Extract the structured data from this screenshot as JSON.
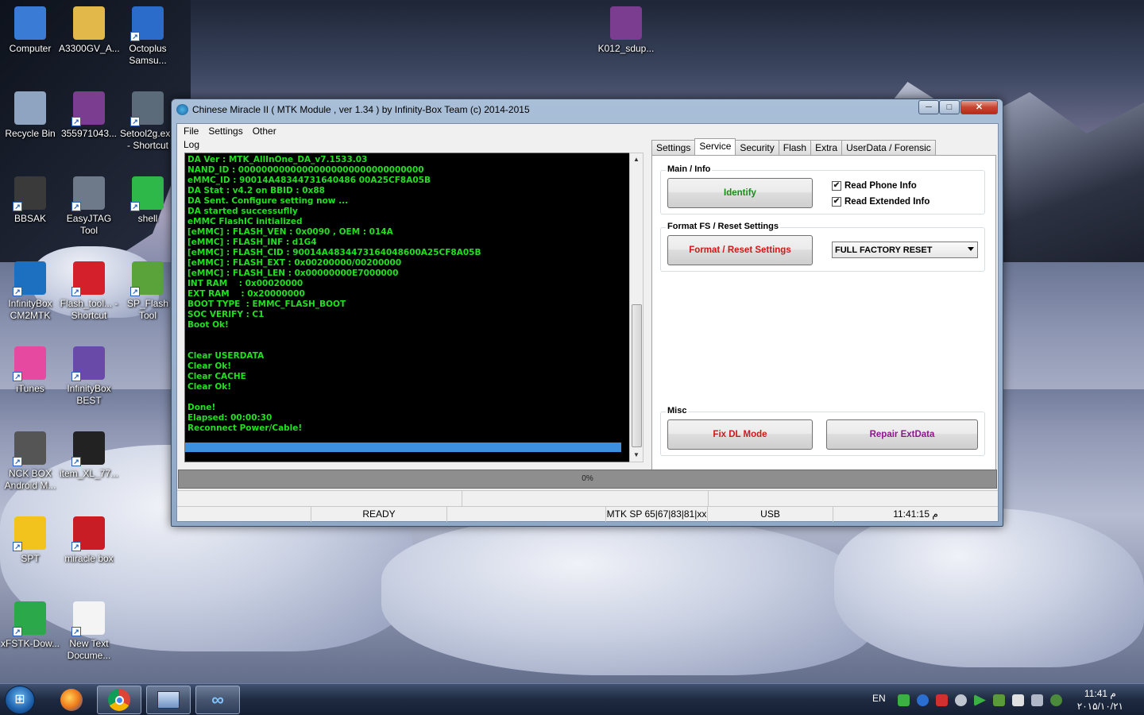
{
  "desktop": {
    "icons": [
      {
        "label": "Computer",
        "color": "#3a7bd5"
      },
      {
        "label": "A3300GV_A...",
        "color": "#e2b84b"
      },
      {
        "label": "Octoplus Samsu...",
        "color": "#2b6bc9"
      },
      {
        "label": "Recycle Bin",
        "color": "#8fa4c0"
      },
      {
        "label": "355971043...",
        "color": "#7a3d8f"
      },
      {
        "label": "Setool2g.exe - Shortcut",
        "color": "#5b6b7a"
      },
      {
        "label": "BBSAK",
        "color": "#3a3a3a"
      },
      {
        "label": "EasyJTAG Tool",
        "color": "#6e7a8a"
      },
      {
        "label": "shell",
        "color": "#2fb84a"
      },
      {
        "label": "InfinityBox CM2MTK",
        "color": "#1d6fbf"
      },
      {
        "label": "Flash_tool... - Shortcut",
        "color": "#d4202a"
      },
      {
        "label": "SP_Flash Tool",
        "color": "#5aa33b"
      },
      {
        "label": "iTunes",
        "color": "#e54aa0"
      },
      {
        "label": "InfinityBox BEST",
        "color": "#6a4aa8"
      },
      {
        "label": "NCK BOX Android M...",
        "color": "#555555"
      },
      {
        "label": "item_XL_77...",
        "color": "#222222"
      },
      {
        "label": "SPT",
        "color": "#f2c31c"
      },
      {
        "label": "miracle box",
        "color": "#c81d25"
      },
      {
        "label": "xFSTK-Dow...",
        "color": "#2aa84a"
      },
      {
        "label": "New Text Docume...",
        "color": "#f4f4f4"
      },
      {
        "label": "K012_sdup...",
        "color": "#7a3d8f"
      }
    ]
  },
  "window": {
    "title": "Chinese Miracle II ( MTK Module , ver 1.34 ) by Infinity-Box Team (c) 2014-2015",
    "buttons": {
      "minimize": "─",
      "maximize": "□",
      "close": "✕"
    },
    "menu": [
      "File",
      "Settings",
      "Other"
    ],
    "log_label": "Log",
    "log_lines": [
      "DA Ver : MTK_AllInOne_DA_v7.1533.03",
      "NAND_ID : 00000000000000000000000000000000",
      "eMMC_ID : 90014A48344731640486 00A25CF8A05B",
      "DA Stat : v4.2 on BBID : 0x88",
      "DA Sent. Configure setting now ...",
      "DA started successuflly",
      "eMMC FlashIC initialized",
      "[eMMC] : FLASH_VEN : 0x0090 , OEM : 014A",
      "[eMMC] : FLASH_INF : d1G4",
      "[eMMC] : FLASH_CID : 90014A4834473164048600A25CF8A05B",
      "[eMMC] : FLASH_EXT : 0x00200000/00200000",
      "[eMMC] : FLASH_LEN : 0x00000000E7000000",
      "INT RAM    : 0x00020000",
      "EXT RAM    : 0x20000000",
      "BOOT TYPE  : EMMC_FLASH_BOOT",
      "SOC VERIFY : C1",
      "Boot Ok!",
      "",
      "",
      "Clear USERDATA",
      "Clear Ok!",
      "Clear CACHE",
      "Clear Ok!",
      "",
      "Done!",
      "Elapsed: 00:00:30",
      "Reconnect Power/Cable!"
    ],
    "tabs": [
      "Settings",
      "Service",
      "Security",
      "Flash",
      "Extra",
      "UserData / Forensic"
    ],
    "active_tab": "Service",
    "service": {
      "main_info": {
        "title": "Main / Info",
        "identify": "Identify",
        "read_phone_info": "Read Phone Info",
        "read_extended_info": "Read Extended Info"
      },
      "format": {
        "title": "Format FS / Reset Settings",
        "button": "Format / Reset Settings",
        "select_value": "FULL FACTORY RESET"
      },
      "misc": {
        "title": "Misc",
        "fix_dl": "Fix DL Mode",
        "repair": "Repair ExtData"
      }
    },
    "progress_text": "0%",
    "progress_value": 0,
    "status": {
      "state": "READY",
      "chip": "MTK SP 65|67|83|81|xx",
      "port": "USB",
      "time": "11:41:15 م"
    },
    "colors": {
      "log_text": "#20e020",
      "identify": "#1a8a1a",
      "format": "#d01818",
      "fix_dl": "#d01818",
      "repair": "#8a1a8a"
    }
  },
  "taskbar": {
    "start_label": "⊞",
    "language": "EN",
    "clock_time": "11:41 م",
    "clock_date": "۲۰۱۵/۱۰/۲۱"
  }
}
